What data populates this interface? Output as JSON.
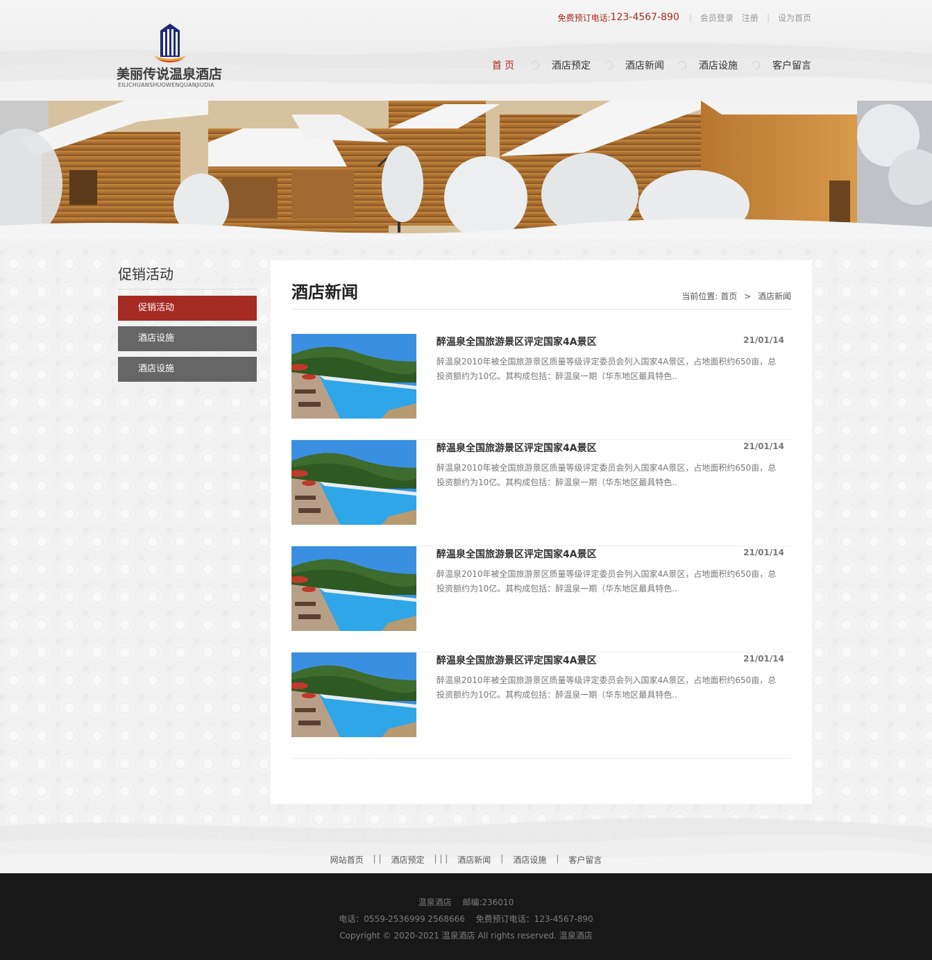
{
  "brand": {
    "name_cn": "美丽传说温泉酒店",
    "name_en": "EILICHUANSHUOWENQUANJIUDIA"
  },
  "topbar": {
    "hotline_label": "免费预订电话:",
    "hotline_number": "123-4567-890",
    "login": "会员登录",
    "register": "注册",
    "set_home": "设为首页"
  },
  "nav": {
    "items": [
      {
        "label": "首页"
      },
      {
        "label": "酒店预定"
      },
      {
        "label": "酒店新闻"
      },
      {
        "label": "酒店设施"
      },
      {
        "label": "客户留言"
      }
    ]
  },
  "sidebar": {
    "title": "促销活动",
    "items": [
      {
        "label": "促销活动"
      },
      {
        "label": "酒店设施"
      },
      {
        "label": "酒店设施"
      }
    ]
  },
  "main": {
    "title": "酒店新闻",
    "breadcrumb": {
      "label": "当前位置:",
      "home": "首页",
      "gt": ">",
      "current": "酒店新闻"
    },
    "news": [
      {
        "title": "醉温泉全国旅游景区评定国家4A景区",
        "date": "21/01/14",
        "desc": "醉温泉2010年被全国旅游景区质量等级评定委员会列入国家4A景区，占地面积约650亩，总投资额约为10亿。其构成包括：醉温泉一期（华东地区最具特色.."
      },
      {
        "title": "醉温泉全国旅游景区评定国家4A景区",
        "date": "21/01/14",
        "desc": "醉温泉2010年被全国旅游景区质量等级评定委员会列入国家4A景区，占地面积约650亩，总投资额约为10亿。其构成包括：醉温泉一期（华东地区最具特色.."
      },
      {
        "title": "醉温泉全国旅游景区评定国家4A景区",
        "date": "21/01/14",
        "desc": "醉温泉2010年被全国旅游景区质量等级评定委员会列入国家4A景区，占地面积约650亩，总投资额约为10亿。其构成包括：醉温泉一期（华东地区最具特色.."
      },
      {
        "title": "醉温泉全国旅游景区评定国家4A景区",
        "date": "21/01/14",
        "desc": "醉温泉2010年被全国旅游景区质量等级评定委员会列入国家4A景区，占地面积约650亩，总投资额约为10亿。其构成包括：醉温泉一期（华东地区最具特色.."
      }
    ]
  },
  "footer_nav": {
    "items": [
      "网站首页",
      "酒店预定",
      "酒店新闻",
      "酒店设施",
      "客户留言"
    ],
    "separators": [
      "| |",
      "| | |",
      "|",
      "|"
    ]
  },
  "footer": {
    "line1": "温泉酒店　 邮编:236010",
    "line2": "电话：0559-2536999  2568666　 免费预订电话：123-4567-890",
    "line3": "Copyright © 2020-2021 温泉酒店  All rights reserved.  温泉酒店"
  },
  "colors": {
    "accent": "#a8281f",
    "sidebar_active": "#a52a22",
    "sidebar_item": "#666666",
    "footer_bg": "#181818"
  }
}
